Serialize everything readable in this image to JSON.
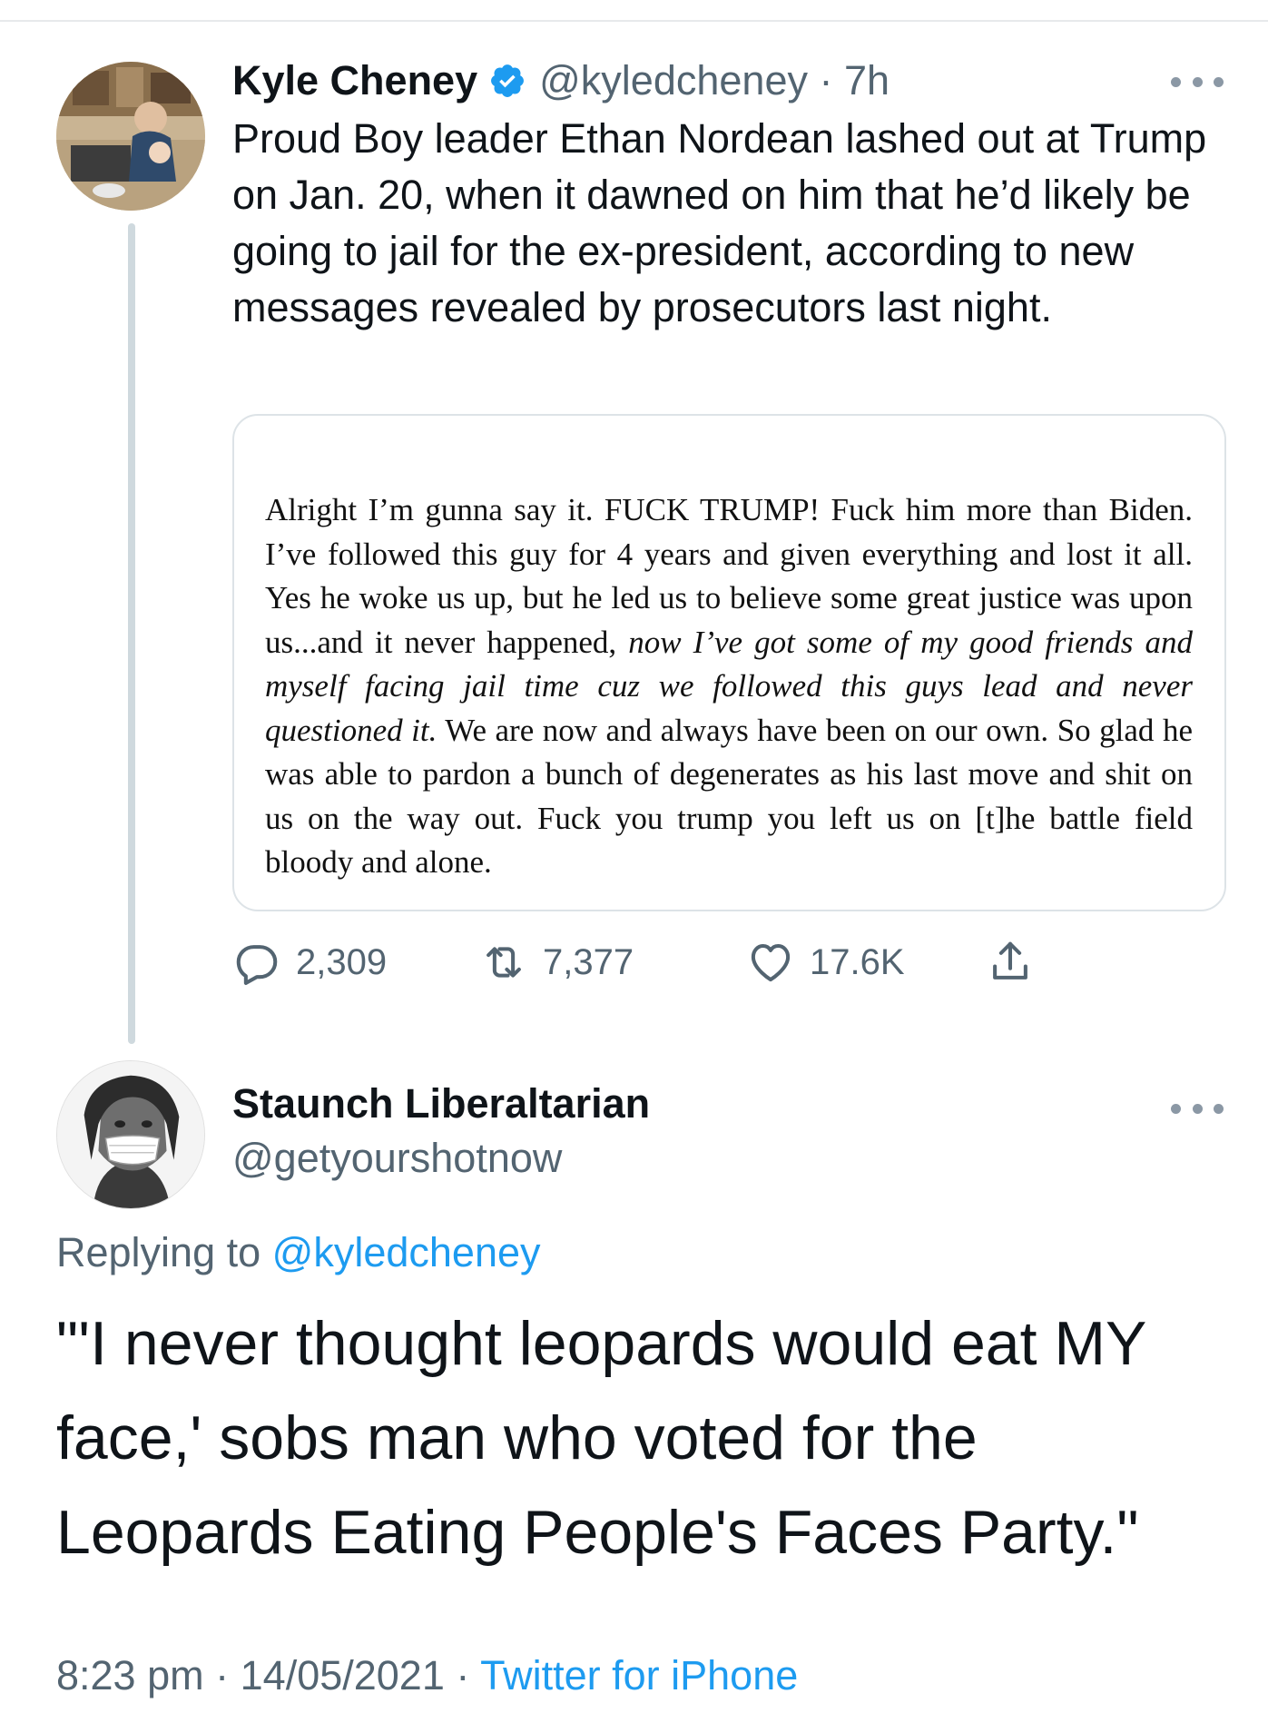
{
  "original_tweet": {
    "author_name": "Kyle Cheney",
    "verified": true,
    "handle": "@kyledcheney",
    "separator": "·",
    "time_ago": "7h",
    "text": "Proud Boy leader Ethan Nordean lashed out at Trump on Jan. 20, when it dawned on him that he’d likely be going to jail for the ex-president, according to new messages revealed by prosecutors last night.",
    "quote_image": {
      "text_part1": "Alright I’m gunna say it. FUCK TRUMP! Fuck him more than Biden. I’ve followed this guy for 4 years and given everything and lost it all. Yes he woke us up, but he led us to believe some great justice was upon us...and it never happened, ",
      "text_italic": "now I’ve got some of my good friends and myself facing jail time cuz we followed this guys lead and never questioned it.",
      "text_part2": " We are now and always have been on our own. So glad he was able to pardon a bunch of degenerates as his last move and shit on us on the way out. Fuck you trump you left us on [t]he battle field bloody and alone."
    },
    "stats": {
      "replies": "2,309",
      "retweets": "7,377",
      "likes": "17.6K"
    }
  },
  "reply_tweet": {
    "author_name": "Staunch Liberaltarian",
    "handle": "@getyourshotnow",
    "replying_to_label": "Replying to",
    "replying_to_handle": "@kyledcheney",
    "text": "\"'I never thought leopards would eat MY face,' sobs man who voted for the Leopards Eating People's Faces Party.\"",
    "time": "8:23 pm",
    "separator": "·",
    "date": "14/05/2021",
    "source": "Twitter for iPhone"
  },
  "icons": {
    "verified": "verified-badge-icon",
    "more": "more-options-icon",
    "reply": "reply-icon",
    "retweet": "retweet-icon",
    "like": "like-icon",
    "share": "share-icon"
  },
  "colors": {
    "primary_text": "#0f1419",
    "secondary_text": "#536471",
    "accent": "#1d9bf0",
    "thread_line": "#cfd9de",
    "card_border": "#dde3e7"
  }
}
